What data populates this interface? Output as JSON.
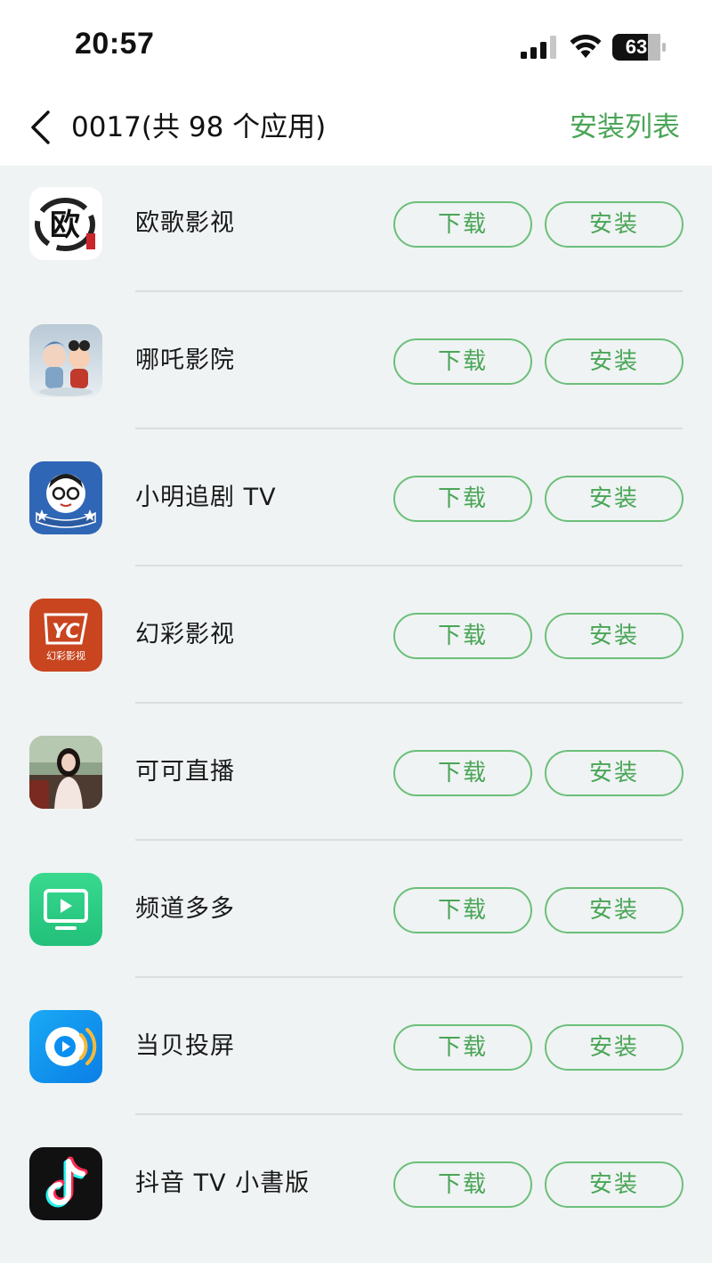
{
  "status_bar": {
    "time": "20:57",
    "battery": "63"
  },
  "nav": {
    "title": "0017(共 98 个应用)",
    "install_list": "安装列表"
  },
  "apps": [
    {
      "name": "欧歌影视",
      "download": "下载",
      "install": "安装",
      "icon": "ouge-calligraphy-icon",
      "icon_text": "欧"
    },
    {
      "name": "哪吒影院",
      "download": "下载",
      "install": "安装",
      "icon": "nezha-cartoon-icon"
    },
    {
      "name": "小明追剧 TV",
      "download": "下载",
      "install": "安装",
      "icon": "xiaoming-glasses-boy-icon"
    },
    {
      "name": "幻彩影视",
      "download": "下载",
      "install": "安装",
      "icon": "huancai-yc-icon",
      "icon_text": "YC",
      "icon_sub": "幻彩影视"
    },
    {
      "name": "可可直播",
      "download": "下载",
      "install": "安装",
      "icon": "keke-live-photo-icon"
    },
    {
      "name": "频道多多",
      "download": "下载",
      "install": "安装",
      "icon": "tv-play-icon"
    },
    {
      "name": "当贝投屏",
      "download": "下载",
      "install": "安装",
      "icon": "dangbei-cast-icon"
    },
    {
      "name": "抖音 TV 小書版",
      "download": "下载",
      "install": "安装",
      "icon": "douyin-note-icon"
    }
  ],
  "colors": {
    "accent": "#4aa557",
    "button_border": "#6cbf7a",
    "background": "#eff3f3"
  }
}
